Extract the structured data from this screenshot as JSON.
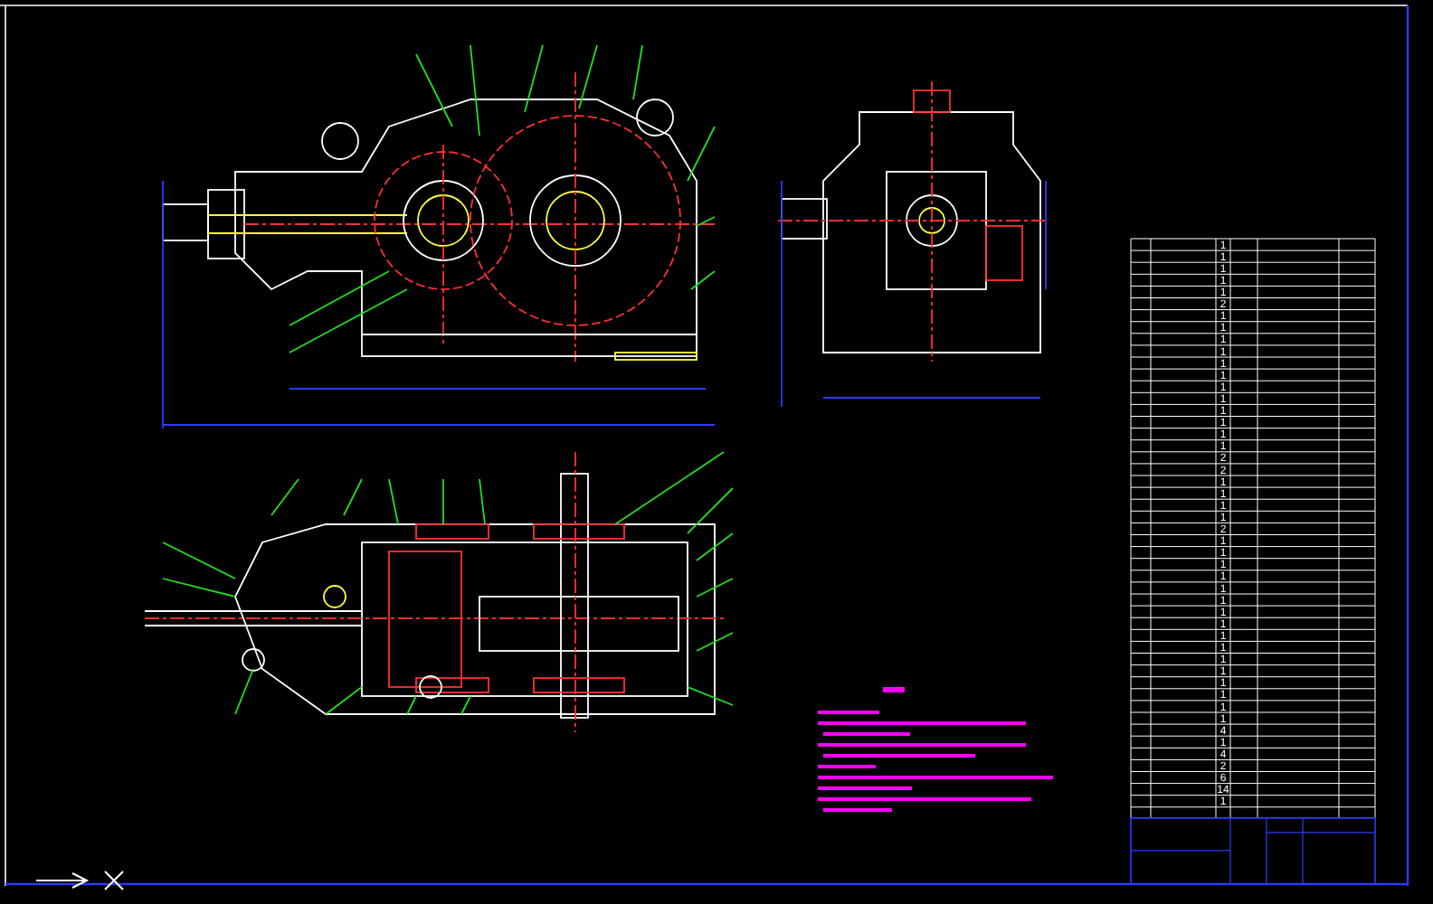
{
  "parts_list": {
    "rows": [
      {
        "quantity": "1"
      },
      {
        "quantity": "1"
      },
      {
        "quantity": "1"
      },
      {
        "quantity": "1"
      },
      {
        "quantity": "1"
      },
      {
        "quantity": "2"
      },
      {
        "quantity": "1"
      },
      {
        "quantity": "1"
      },
      {
        "quantity": "1"
      },
      {
        "quantity": "1"
      },
      {
        "quantity": "1"
      },
      {
        "quantity": "1"
      },
      {
        "quantity": "1"
      },
      {
        "quantity": "1"
      },
      {
        "quantity": "1"
      },
      {
        "quantity": "1"
      },
      {
        "quantity": "1"
      },
      {
        "quantity": "1"
      },
      {
        "quantity": "2"
      },
      {
        "quantity": "2"
      },
      {
        "quantity": "1"
      },
      {
        "quantity": "1"
      },
      {
        "quantity": "1"
      },
      {
        "quantity": "1"
      },
      {
        "quantity": "2"
      },
      {
        "quantity": "1"
      },
      {
        "quantity": "1"
      },
      {
        "quantity": "1"
      },
      {
        "quantity": "1"
      },
      {
        "quantity": "1"
      },
      {
        "quantity": "1"
      },
      {
        "quantity": "1"
      },
      {
        "quantity": "1"
      },
      {
        "quantity": "1"
      },
      {
        "quantity": "1"
      },
      {
        "quantity": "1"
      },
      {
        "quantity": "1"
      },
      {
        "quantity": "1"
      },
      {
        "quantity": "1"
      },
      {
        "quantity": "1"
      },
      {
        "quantity": "1"
      },
      {
        "quantity": "4"
      },
      {
        "quantity": "1"
      },
      {
        "quantity": "4"
      },
      {
        "quantity": "2"
      },
      {
        "quantity": "6"
      },
      {
        "quantity": "14"
      },
      {
        "quantity": "1"
      }
    ]
  }
}
